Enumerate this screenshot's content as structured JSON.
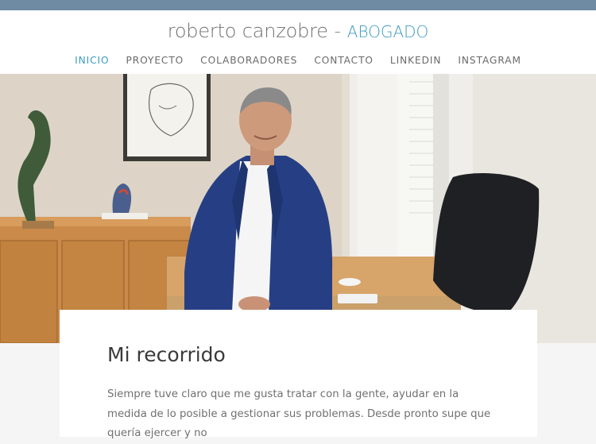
{
  "header": {
    "site_name": "roberto canzobre",
    "separator": "-",
    "role": "ABOGADO"
  },
  "nav": {
    "items": [
      "INICIO",
      "PROYECTO",
      "COLABORADORES",
      "CONTACTO",
      "LINKEDIN",
      "INSTAGRAM"
    ],
    "active": "INICIO"
  },
  "hero": {
    "image": "hero-office-portrait"
  },
  "content": {
    "title": "Mi recorrido",
    "paragraph": "Siempre tuve claro que me gusta tratar con la gente, ayudar en la medida de lo posible a gestionar sus problemas. Desde pronto supe que quería ejercer y no"
  },
  "colors": {
    "accent": "#3d9bc1",
    "top_strip": "#6f8aa3",
    "nav_text": "#6a6a6a",
    "title_text": "#707070",
    "body_text": "#707070",
    "heading_text": "#3a3a3a"
  }
}
